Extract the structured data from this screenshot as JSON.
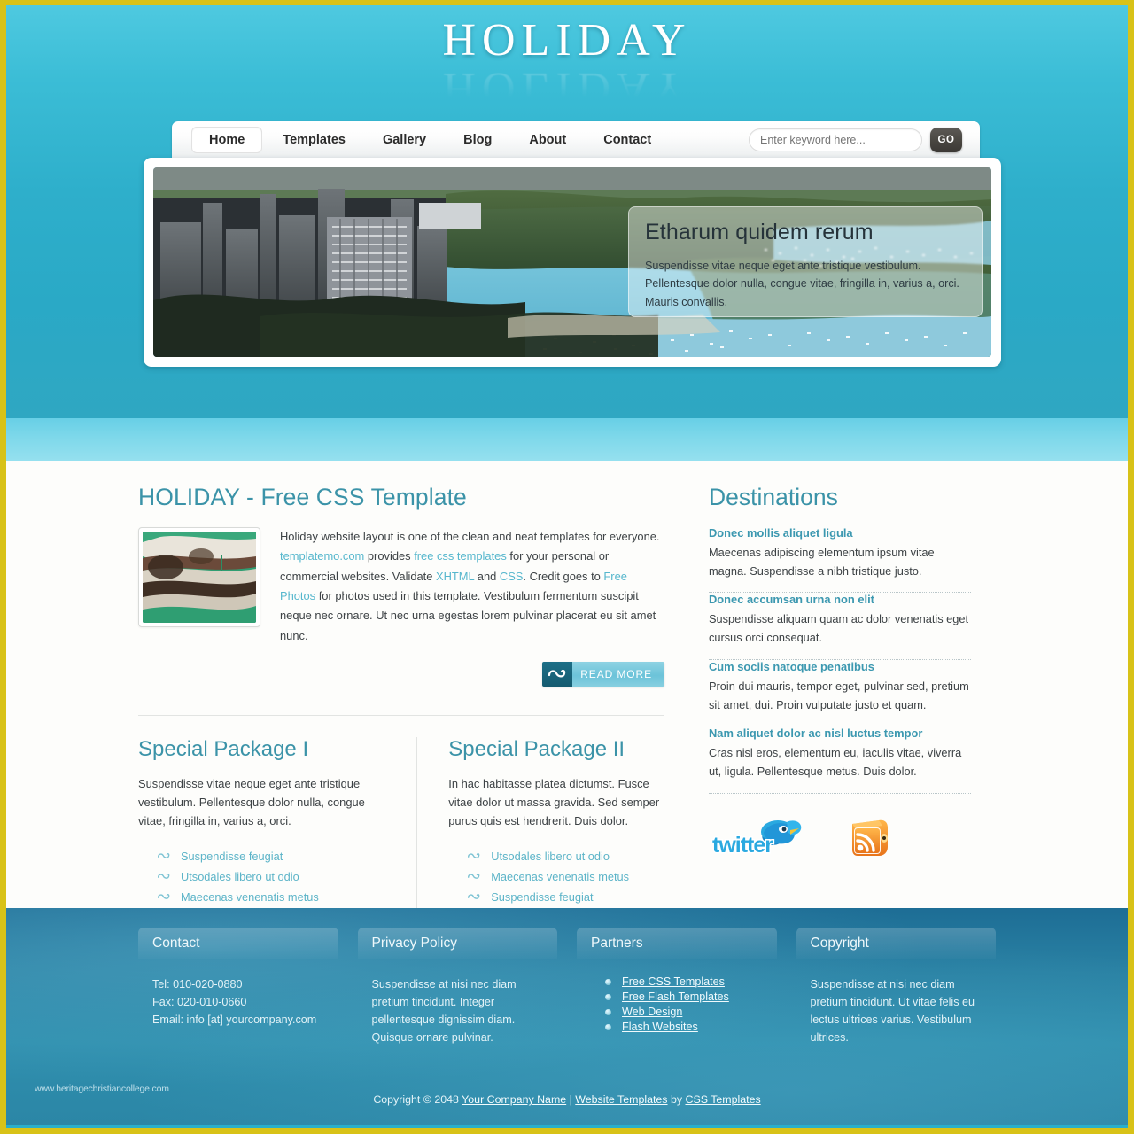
{
  "site": {
    "logo": "HOLIDAY"
  },
  "nav": {
    "items": [
      {
        "label": "Home",
        "active": true
      },
      {
        "label": "Templates",
        "active": false
      },
      {
        "label": "Gallery",
        "active": false
      },
      {
        "label": "Blog",
        "active": false
      },
      {
        "label": "About",
        "active": false
      },
      {
        "label": "Contact",
        "active": false
      }
    ],
    "search_placeholder": "Enter keyword here...",
    "search_value": "",
    "go_label": "GO"
  },
  "banner": {
    "image_alt": "aerial-view-of-chicago-lakefront-and-marina",
    "caption_title": "Etharum quidem rerum",
    "caption_text": "Suspendisse vitae neque eget ante tristique vestibulum. Pellentesque dolor nulla, congue vitae, fringilla in, varius a, orci. Mauris convallis."
  },
  "main": {
    "title": "HOLIDAY - Free CSS Template",
    "thumb_alt": "aerial-view-of-park-lagoon",
    "intro": {
      "p1": "Holiday website layout is one of the clean and neat templates for everyone. ",
      "link1": "templatemo.com",
      "p2": " provides ",
      "link2": "free css templates",
      "p3": " for your personal or commercial websites. Validate ",
      "link3": "XHTML",
      "p4": " and ",
      "link4": "CSS",
      "p5": ". Credit goes to ",
      "link5": "Free Photos",
      "p6": " for photos used in this template. Vestibulum fermentum suscipit neque nec ornare. Ut nec urna egestas lorem pulvinar placerat eu sit amet nunc."
    },
    "read_more": "READ MORE",
    "packages": [
      {
        "title": "Special Package I",
        "text": "Suspendisse vitae neque eget ante tristique vestibulum. Pellentesque dolor nulla, congue vitae, fringilla in, varius a, orci.",
        "links": [
          "Suspendisse feugiat",
          "Utsodales libero ut odio",
          "Maecenas venenatis metus"
        ]
      },
      {
        "title": "Special Package II",
        "text": "In hac habitasse platea dictumst. Fusce vitae dolor ut massa gravida. Sed semper purus quis est hendrerit. Duis dolor.",
        "links": [
          "Utsodales libero ut odio",
          "Maecenas venenatis metus",
          "Suspendisse feugiat"
        ]
      }
    ]
  },
  "sidebar": {
    "title": "Destinations",
    "items": [
      {
        "link": "Donec mollis aliquet ligula",
        "text": "Maecenas adipiscing elementum ipsum vitae magna. Suspendisse a nibh tristique justo."
      },
      {
        "link": "Donec accumsan urna non elit",
        "text": "Suspendisse aliquam quam ac dolor venenatis eget cursus orci consequat."
      },
      {
        "link": "Cum sociis natoque penatibus",
        "text": "Proin dui mauris, tempor eget, pulvinar sed, pretium sit amet, dui. Proin vulputate justo et quam."
      },
      {
        "link": "Nam aliquet dolor ac nisl luctus tempor",
        "text": "Cras nisl eros, elementum eu, iaculis vitae, viverra ut, ligula. Pellentesque metus. Duis dolor."
      }
    ],
    "social": {
      "twitter_label": "twitter",
      "rss_label": "rss"
    }
  },
  "footer": {
    "columns": [
      {
        "title": "Contact",
        "lines": [
          "Tel: 010-020-0880",
          "Fax: 020-010-0660",
          "Email: info [at] yourcompany.com"
        ]
      },
      {
        "title": "Privacy Policy",
        "text": "Suspendisse at nisi nec diam pretium tincidunt. Integer pellentesque dignissim diam. Quisque ornare pulvinar."
      },
      {
        "title": "Partners",
        "links": [
          "Free CSS Templates",
          "Free Flash Templates",
          "Web Design",
          "Flash Websites"
        ]
      },
      {
        "title": "Copyright",
        "text": "Suspendisse at nisi nec diam pretium tincidunt. Ut vitae felis eu lectus ultrices varius. Vestibulum ultrices."
      }
    ],
    "copyright_prefix": "Copyright © 2048 ",
    "copyright_company": "Your Company Name",
    "copyright_sep": " | ",
    "copyright_link1": "Website Templates",
    "copyright_by": " by ",
    "copyright_link2": "CSS Templates",
    "watermark": "www.heritagechristiancollege.com"
  },
  "colors": {
    "header_blue": "#2aafca",
    "accent_teal": "#3b93a8",
    "link_teal": "#56b7cd",
    "footer_blue": "#2a82a4",
    "frame_gold": "#d8c218"
  }
}
